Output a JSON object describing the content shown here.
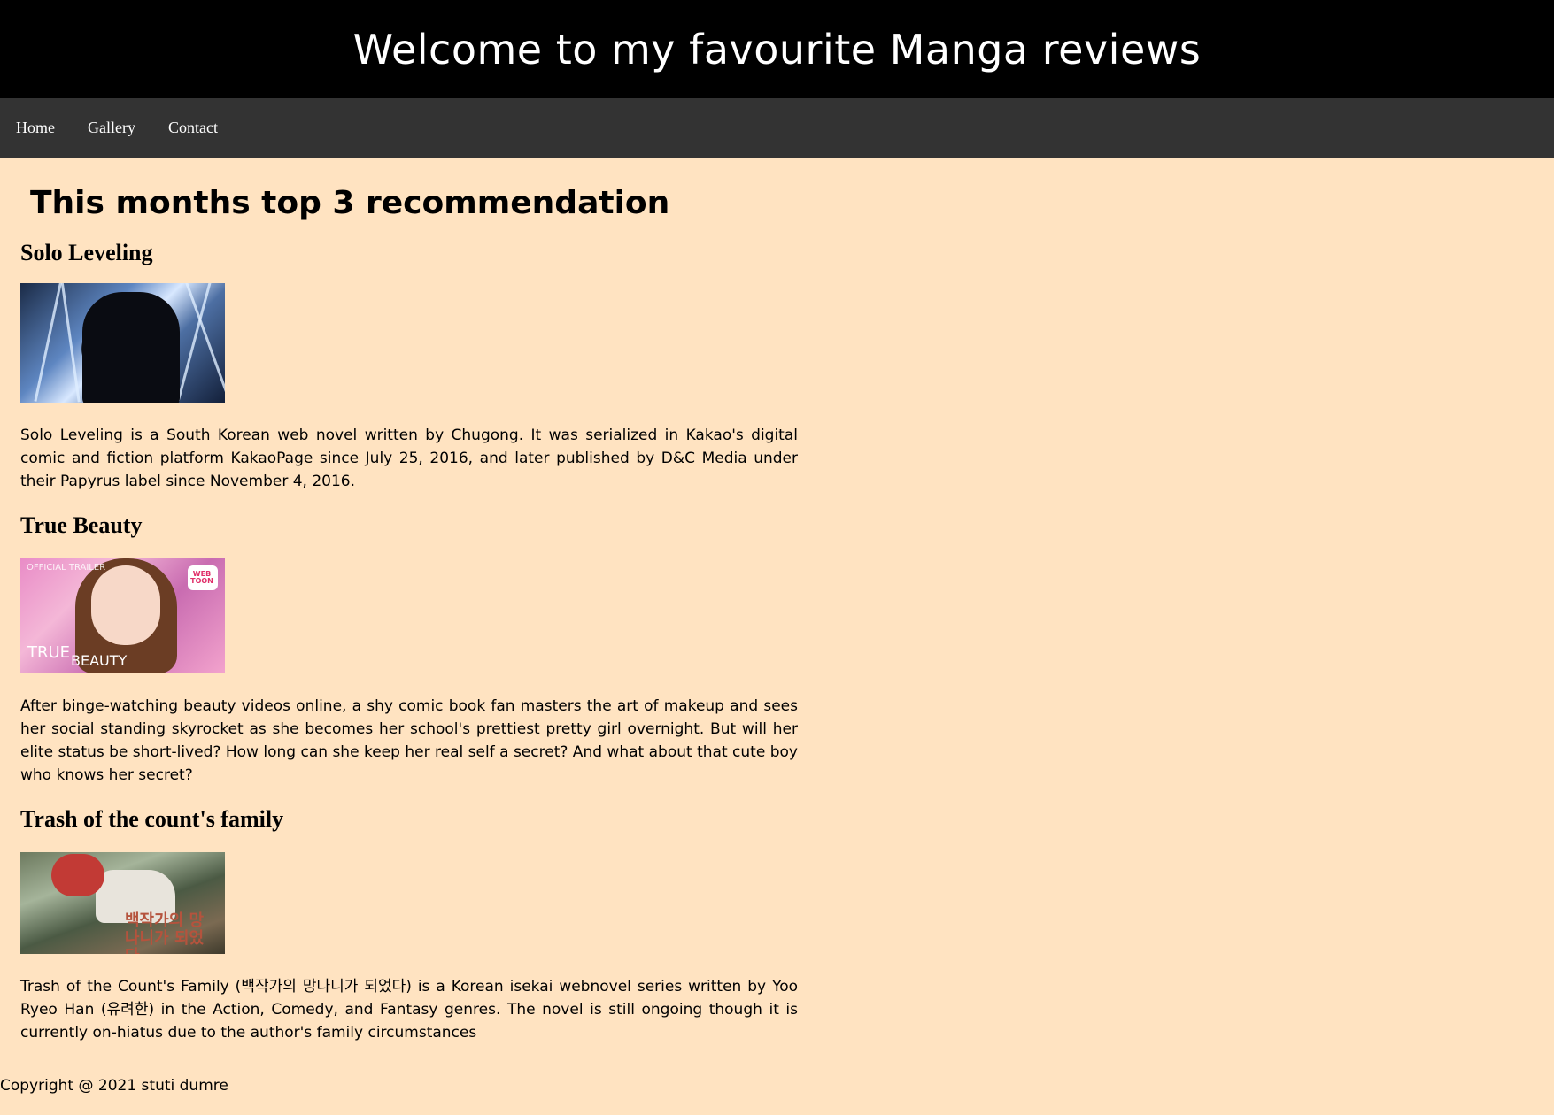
{
  "header": {
    "title": "Welcome to my favourite Manga reviews"
  },
  "nav": {
    "items": [
      "Home",
      "Gallery",
      "Contact"
    ]
  },
  "main": {
    "section_title": "This months top 3 recommendation",
    "reviews": [
      {
        "title": "Solo Leveling",
        "image_alt": "",
        "text": "Solo Leveling is a South Korean web novel written by Chugong. It was serialized in Kakao's digital comic and fiction platform KakaoPage since July 25, 2016, and later published by D&C Media under their Papyrus label since November 4, 2016."
      },
      {
        "title": "True Beauty",
        "image_alt": "",
        "image_texts": {
          "trailer": "OFFICIAL TRAILER",
          "badge": "WEB TOON",
          "true": "TRUE",
          "beauty": "BEAUTY"
        },
        "text": "After binge-watching beauty videos online, a shy comic book fan masters the art of makeup and sees her social standing skyrocket as she becomes her school's prettiest pretty girl overnight. But will her elite status be short-lived? How long can she keep her real self a secret? And what about that cute boy who knows her secret?"
      },
      {
        "title": "Trash of the count's family",
        "image_alt": "",
        "image_texts": {
          "korean": "백작가의 망나니가 되었다"
        },
        "text": "Trash of the Count's Family (백작가의 망나니가 되었다) is a Korean isekai webnovel series written by Yoo Ryeo Han (유려한) in the Action, Comedy, and Fantasy genres. The novel is still ongoing though it is currently on-hiatus due to the author's family circumstances"
      }
    ]
  },
  "footer": {
    "text": "Copyright @ 2021 stuti dumre"
  }
}
